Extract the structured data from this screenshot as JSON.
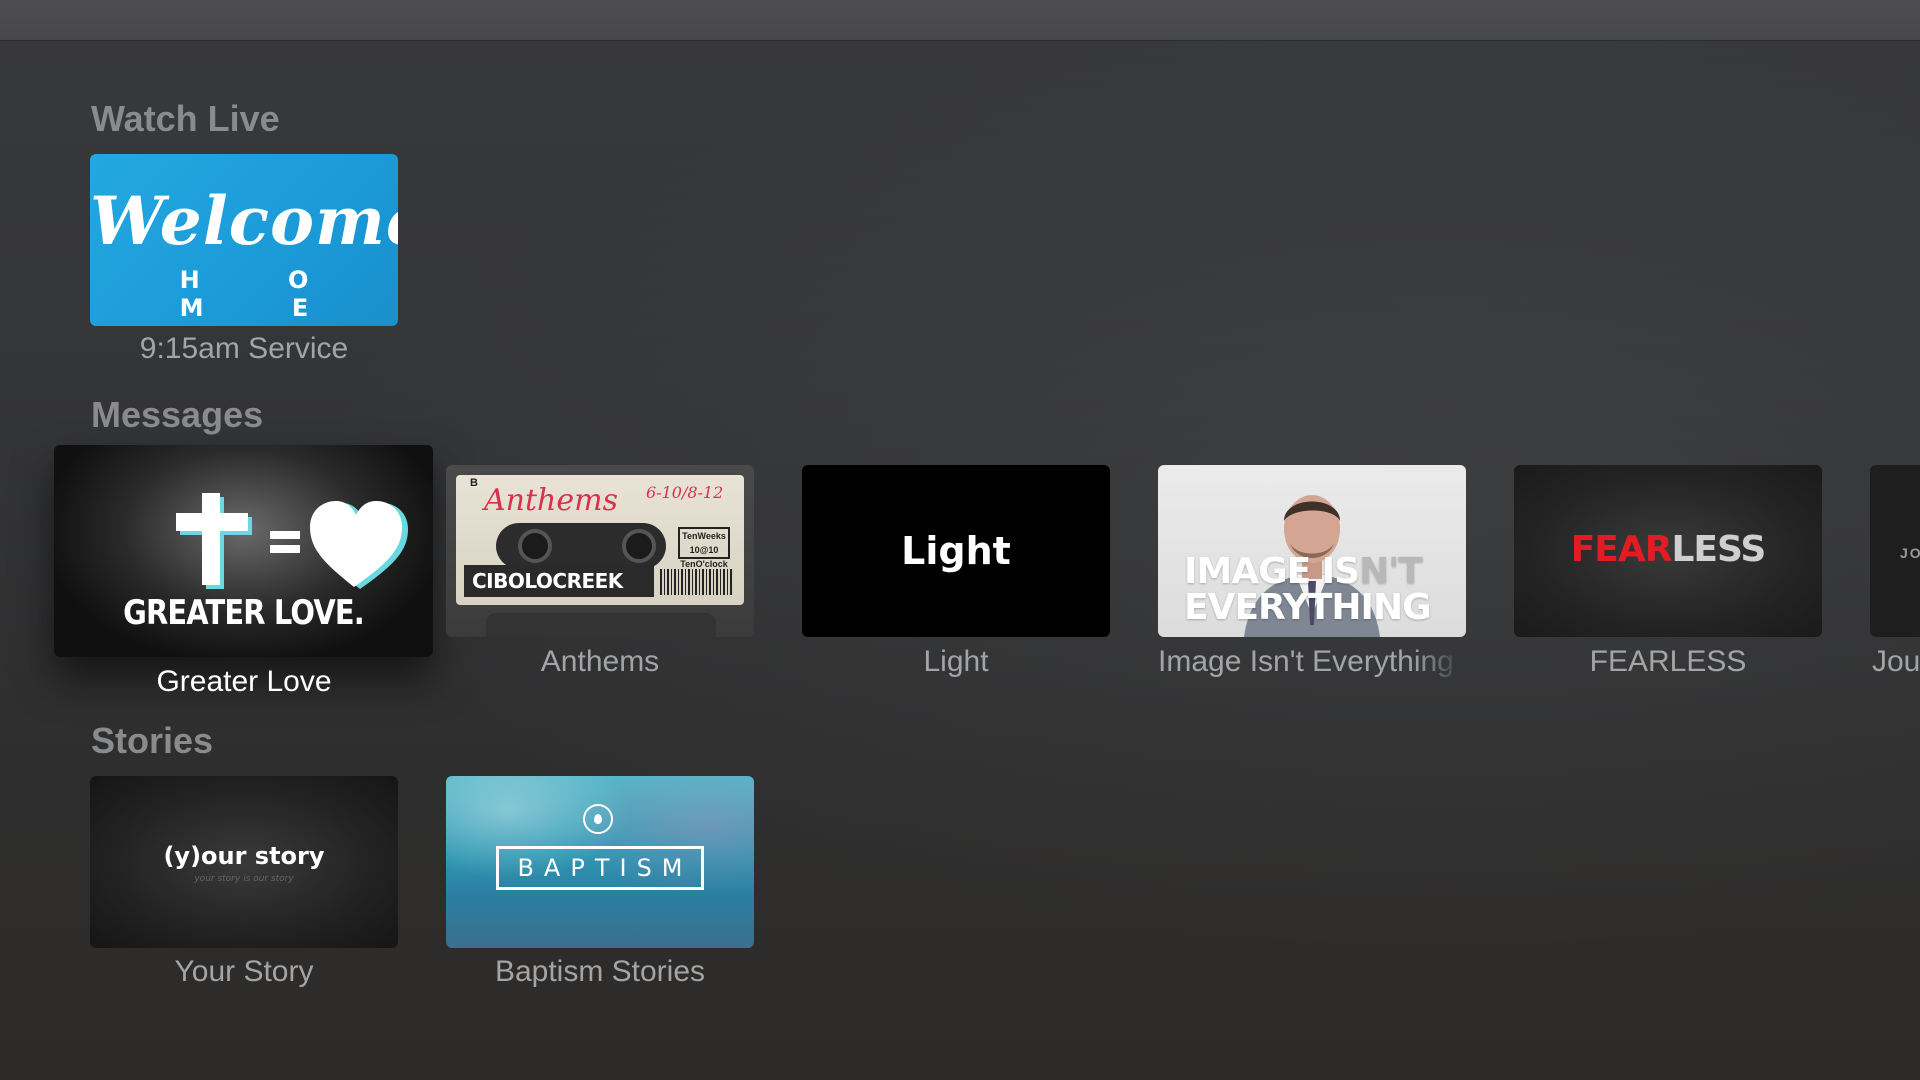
{
  "sections": {
    "watch_live": {
      "title": "Watch Live",
      "items": [
        {
          "label": "9:15am Service",
          "art": {
            "script": "Welcome",
            "sub": "H O M E"
          }
        }
      ]
    },
    "messages": {
      "title": "Messages",
      "items": [
        {
          "label": "Greater Love",
          "focused": true,
          "art": {
            "caption": "GREATER LOVE."
          }
        },
        {
          "label": "Anthems",
          "art": {
            "script": "Anthems",
            "b": "B",
            "dates": "6-10/8-12",
            "brand": "CIBOLOCREEK",
            "box": "TenWeeks 10@10 TenO'clock"
          }
        },
        {
          "label": "Light",
          "art": {
            "word": "Light"
          }
        },
        {
          "label": "Image Isn't Everything",
          "art": {
            "line1_bright": "IMAGE IS",
            "line1_dim": "N'T",
            "line2": "EVERYTHING"
          }
        },
        {
          "label": "FEARLESS",
          "art": {
            "red": "FEAR",
            "grey": "LESS"
          }
        },
        {
          "label": "Jou",
          "art": {
            "text": "JO"
          }
        }
      ]
    },
    "stories": {
      "title": "Stories",
      "items": [
        {
          "label": "Your Story",
          "art": {
            "word": "(y)our story",
            "sub": "your story is our story"
          }
        },
        {
          "label": "Baptism Stories",
          "art": {
            "word": "BAPTISM"
          }
        }
      ]
    }
  },
  "colors": {
    "background": "#333436",
    "section_title": "#8a8b8d",
    "label": "#a3a4a6",
    "label_focused": "#ffffff",
    "welcome_blue": "#1b9ad8",
    "fearless_red": "#e41b23",
    "anthems_red": "#d9314d"
  }
}
